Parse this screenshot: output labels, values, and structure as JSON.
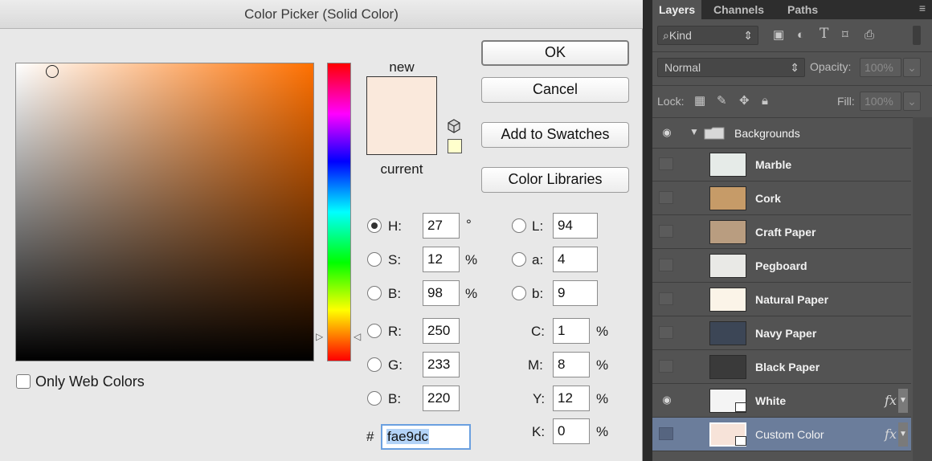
{
  "dialog": {
    "title": "Color Picker (Solid Color)",
    "new_label": "new",
    "current_label": "current",
    "new_color": "#fae9dc",
    "web_safe_swatch": "#ffffcc",
    "only_web_colors": "Only Web Colors",
    "buttons": {
      "ok": "OK",
      "cancel": "Cancel",
      "add_to_swatches": "Add to Swatches",
      "color_libraries": "Color Libraries"
    },
    "hsb": {
      "h": {
        "label": "H:",
        "value": "27",
        "unit": "°",
        "selected": true
      },
      "s": {
        "label": "S:",
        "value": "12",
        "unit": "%"
      },
      "b": {
        "label": "B:",
        "value": "98",
        "unit": "%"
      }
    },
    "rgb": {
      "r": {
        "label": "R:",
        "value": "250"
      },
      "g": {
        "label": "G:",
        "value": "233"
      },
      "b": {
        "label": "B:",
        "value": "220"
      }
    },
    "lab": {
      "l": {
        "label": "L:",
        "value": "94"
      },
      "a": {
        "label": "a:",
        "value": "4"
      },
      "b": {
        "label": "b:",
        "value": "9"
      }
    },
    "cmyk": {
      "c": {
        "label": "C:",
        "value": "1",
        "unit": "%"
      },
      "m": {
        "label": "M:",
        "value": "8",
        "unit": "%"
      },
      "y": {
        "label": "Y:",
        "value": "12",
        "unit": "%"
      },
      "k": {
        "label": "K:",
        "value": "0",
        "unit": "%"
      }
    },
    "hex_prefix": "#",
    "hex": "fae9dc"
  },
  "panel": {
    "tabs": [
      "Layers",
      "Channels",
      "Paths"
    ],
    "filter_kind": "Kind",
    "blend_mode": "Normal",
    "opacity_label": "Opacity:",
    "opacity_value": "100%",
    "lock_label": "Lock:",
    "fill_label": "Fill:",
    "fill_value": "100%",
    "group": "Backgrounds",
    "layers": [
      {
        "name": "Marble",
        "color": "#e6ebe8",
        "visible": false
      },
      {
        "name": "Cork",
        "color": "#c69b68",
        "visible": false
      },
      {
        "name": "Craft Paper",
        "color": "#b99d80",
        "visible": false
      },
      {
        "name": "Pegboard",
        "color": "#e9e9e6",
        "visible": false
      },
      {
        "name": "Natural Paper",
        "color": "#fbf4e8",
        "visible": false
      },
      {
        "name": "Navy Paper",
        "color": "#3c4656",
        "visible": false
      },
      {
        "name": "Black Paper",
        "color": "#3a3a3a",
        "visible": false
      },
      {
        "name": "White",
        "color": "#f4f4f4",
        "visible": true,
        "fx": "fx"
      },
      {
        "name": "Custom Color",
        "color": "#f7e3d9",
        "visible": false,
        "fx": "fx",
        "selected": true
      }
    ]
  }
}
